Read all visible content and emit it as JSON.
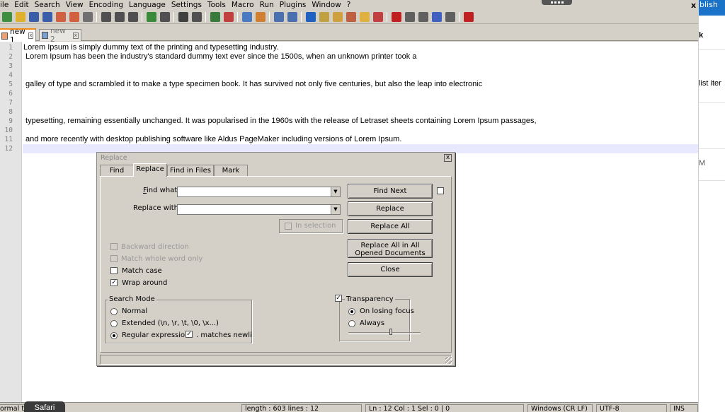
{
  "menu": [
    "ile",
    "Edit",
    "Search",
    "View",
    "Encoding",
    "Language",
    "Settings",
    "Tools",
    "Macro",
    "Run",
    "Plugins",
    "Window",
    "?"
  ],
  "close_glyph": "x",
  "toolbar_icons": [
    {
      "name": "new-file-icon",
      "color": "#3d8f3d"
    },
    {
      "name": "open-file-icon",
      "color": "#e0b030"
    },
    {
      "name": "save-icon",
      "color": "#3a5fa8"
    },
    {
      "name": "save-all-icon",
      "color": "#3a5fa8"
    },
    {
      "name": "close-icon",
      "color": "#d06040"
    },
    {
      "name": "close-all-icon",
      "color": "#d06040"
    },
    {
      "name": "print-icon",
      "color": "#707070"
    },
    {
      "sep": true
    },
    {
      "name": "cut-icon",
      "color": "#505050"
    },
    {
      "name": "copy-icon",
      "color": "#505050"
    },
    {
      "name": "paste-icon",
      "color": "#505050"
    },
    {
      "sep": true
    },
    {
      "name": "undo-icon",
      "color": "#3a8a3a"
    },
    {
      "name": "redo-icon",
      "color": "#505050"
    },
    {
      "sep": true
    },
    {
      "name": "find-icon",
      "color": "#404040"
    },
    {
      "name": "replace-icon",
      "color": "#505050"
    },
    {
      "sep": true
    },
    {
      "name": "zoom-in-icon",
      "color": "#3a7a3a"
    },
    {
      "name": "zoom-out-icon",
      "color": "#c04040"
    },
    {
      "sep": true
    },
    {
      "name": "sync-vertical-icon",
      "color": "#4a7ac0"
    },
    {
      "name": "sync-horizontal-icon",
      "color": "#d08030"
    },
    {
      "sep": true
    },
    {
      "name": "word-wrap-icon",
      "color": "#4a70b0"
    },
    {
      "name": "all-chars-icon",
      "color": "#4a70b0"
    },
    {
      "sep": true
    },
    {
      "name": "indent-guide-icon",
      "color": "#2060c0"
    },
    {
      "name": "udl-icon",
      "color": "#c0a040"
    },
    {
      "name": "doc-map-icon",
      "color": "#d0a040"
    },
    {
      "name": "function-list-icon",
      "color": "#c06040"
    },
    {
      "name": "folder-workspace-icon",
      "color": "#e0b040"
    },
    {
      "name": "monitoring-icon",
      "color": "#c04040"
    },
    {
      "sep": true
    },
    {
      "name": "record-macro-icon",
      "color": "#c02020"
    },
    {
      "name": "stop-record-icon",
      "color": "#606060"
    },
    {
      "name": "play-macro-icon",
      "color": "#606060"
    },
    {
      "name": "run-macro-multiple-icon",
      "color": "#4060c0"
    },
    {
      "name": "save-macro-icon",
      "color": "#606060"
    },
    {
      "sep": true
    },
    {
      "name": "spell-check-icon",
      "color": "#c02020"
    }
  ],
  "file_tabs": [
    {
      "label": "new 1",
      "active": true
    },
    {
      "label": "new 2",
      "active": false
    }
  ],
  "editor": {
    "lines": [
      "Lorem Ipsum is simply dummy text of the printing and typesetting industry.",
      " Lorem Ipsum has been the industry's standard dummy text ever since the 1500s, when an unknown printer took a",
      "",
      "",
      " galley of type and scrambled it to make a type specimen book. It has survived not only five centuries, but also the leap into electronic",
      "",
      "",
      "",
      " typesetting, remaining essentially unchanged. It was popularised in the 1960s with the release of Letraset sheets containing Lorem Ipsum passages,",
      "",
      " and more recently with desktop publishing software like Aldus PageMaker including versions of Lorem Ipsum.",
      ""
    ]
  },
  "statusbar": {
    "mode": "ormal te",
    "length": "length : 603    lines : 12",
    "pos": "Ln : 12    Col : 1    Sel : 0 | 0",
    "eol": "Windows (CR LF)",
    "encoding": "UTF-8",
    "ins": "INS"
  },
  "right_strip": {
    "publish": "blish",
    "k": "k",
    "list_item": "list iter",
    "m": "M"
  },
  "tooltip": "Safari",
  "dialog": {
    "title": "Replace",
    "close": "x",
    "tabs": [
      "Find",
      "Replace",
      "Find in Files",
      "Mark"
    ],
    "find_what_label": "Find what",
    "find_what_value": "",
    "replace_with_label": "Replace with",
    "replace_with_value": "",
    "in_selection": "In selection",
    "options": {
      "backward": "Backward direction",
      "whole_word": "Match whole word only",
      "match_case": "Match case",
      "wrap_around": "Wrap around"
    },
    "search_mode": {
      "title": "Search Mode",
      "normal": "Normal",
      "extended": "Extended (\\n, \\r, \\t, \\0, \\x...)",
      "regex": "Regular expression",
      "matches_newline": ". matches newli"
    },
    "transparency": {
      "title": "Transparency",
      "on_losing_focus": "On losing focus",
      "always": "Always",
      "level": 0.6
    },
    "buttons": {
      "find_next": "Find Next",
      "replace": "Replace",
      "replace_all": "Replace All",
      "replace_all_docs_1": "Replace All in All",
      "replace_all_docs_2": "Opened Documents",
      "close": "Close"
    }
  }
}
